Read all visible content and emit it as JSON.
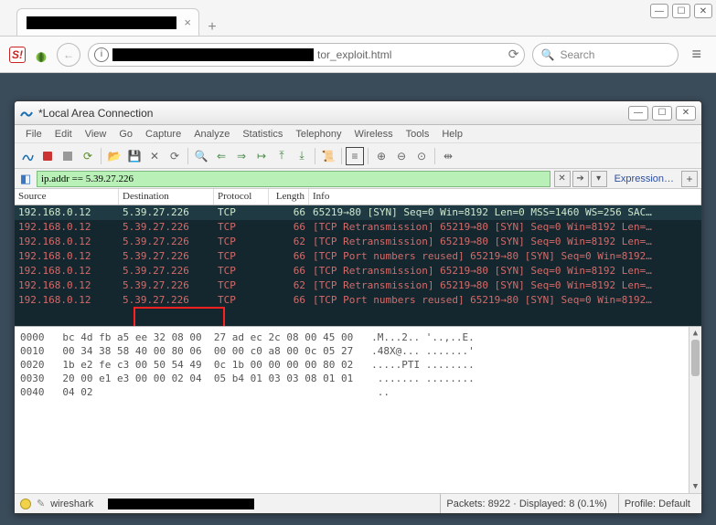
{
  "browser": {
    "tab_title": "████████████████",
    "newtab": "+",
    "url_suffix": "tor_exploit.html",
    "search_placeholder": "Search"
  },
  "window": {
    "title": "*Local Area Connection"
  },
  "menu": [
    "File",
    "Edit",
    "View",
    "Go",
    "Capture",
    "Analyze",
    "Statistics",
    "Telephony",
    "Wireless",
    "Tools",
    "Help"
  ],
  "filter": {
    "value": "ip.addr == 5.39.27.226",
    "expr_label": "Expression…"
  },
  "packets": {
    "headers": {
      "src": "Source",
      "dst": "Destination",
      "proto": "Protocol",
      "len": "Length",
      "info": "Info"
    },
    "rows": [
      {
        "src": "192.168.0.12",
        "dst": "5.39.27.226",
        "proto": "TCP",
        "len": "66",
        "info": "65219→80 [SYN] Seq=0 Win=8192 Len=0 MSS=1460 WS=256 SAC…",
        "cls": "r-sel"
      },
      {
        "src": "192.168.0.12",
        "dst": "5.39.27.226",
        "proto": "TCP",
        "len": "66",
        "info": "[TCP Retransmission] 65219→80 [SYN] Seq=0 Win=8192 Len=…",
        "cls": "r-bad"
      },
      {
        "src": "192.168.0.12",
        "dst": "5.39.27.226",
        "proto": "TCP",
        "len": "62",
        "info": "[TCP Retransmission] 65219→80 [SYN] Seq=0 Win=8192 Len=…",
        "cls": "r-bad"
      },
      {
        "src": "192.168.0.12",
        "dst": "5.39.27.226",
        "proto": "TCP",
        "len": "66",
        "info": "[TCP Port numbers reused] 65219→80 [SYN] Seq=0 Win=8192…",
        "cls": "r-bad"
      },
      {
        "src": "192.168.0.12",
        "dst": "5.39.27.226",
        "proto": "TCP",
        "len": "66",
        "info": "[TCP Retransmission] 65219→80 [SYN] Seq=0 Win=8192 Len=…",
        "cls": "r-bad"
      },
      {
        "src": "192.168.0.12",
        "dst": "5.39.27.226",
        "proto": "TCP",
        "len": "62",
        "info": "[TCP Retransmission] 65219→80 [SYN] Seq=0 Win=8192 Len=…",
        "cls": "r-bad"
      },
      {
        "src": "192.168.0.12",
        "dst": "5.39.27.226",
        "proto": "TCP",
        "len": "66",
        "info": "[TCP Port numbers reused] 65219→80 [SYN] Seq=0 Win=8192…",
        "cls": "r-bad"
      }
    ]
  },
  "hex": {
    "lines": [
      "0000   bc 4d fb a5 ee 32 08 00  27 ad ec 2c 08 00 45 00   .M...2.. '..,..E.",
      "0010   00 34 38 58 40 00 80 06  00 00 c0 a8 00 0c 05 27   .48X@... .......'",
      "0020   1b e2 fe c3 00 50 54 49  0c 1b 00 00 00 00 80 02   .....PTI ........",
      "0030   20 00 e1 e3 00 00 02 04  05 b4 01 03 03 08 01 01    ....... ........",
      "0040   04 02                                               ..              "
    ]
  },
  "status": {
    "file_prefix": "wireshark",
    "packets": "Packets: 8922 · Displayed: 8 (0.1%)",
    "profile": "Profile: Default"
  }
}
